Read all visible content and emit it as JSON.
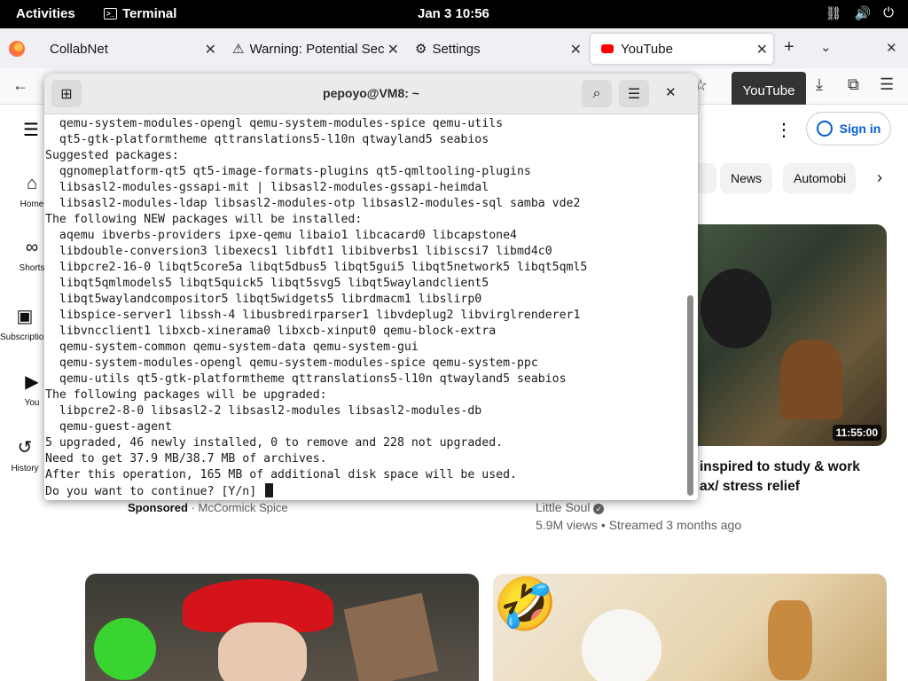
{
  "topbar": {
    "activities": "Activities",
    "app_name": "Terminal",
    "clock": "Jan 3  10:56"
  },
  "browser": {
    "tabs": [
      {
        "title": "CollabNet"
      },
      {
        "title": "Warning: Potential Sec"
      },
      {
        "title": "Settings"
      },
      {
        "title": "YouTube"
      }
    ],
    "tooltip": "YouTube",
    "new_tab": "+",
    "close_window": "✕"
  },
  "youtube": {
    "sidebar": [
      "Home",
      "Shorts",
      "Subscriptions",
      "You",
      "History"
    ],
    "sign_in": "Sign in",
    "chips": [
      "News",
      "Automobi"
    ],
    "video1": {
      "title_line1": "inspired to study & work",
      "title_line2": "ax/ stress relief",
      "channel": "Little Soul",
      "meta": "5.9M views • Streamed 3 months ago",
      "duration": "11:55:00"
    },
    "ad": {
      "sponsored": "Sponsored",
      "advertiser": "McCormick Spice"
    },
    "emoji": "🤣"
  },
  "terminal": {
    "title": "pepoyo@VM8: ~",
    "lines": [
      "  qemu-system-modules-opengl qemu-system-modules-spice qemu-utils",
      "  qt5-gtk-platformtheme qttranslations5-l10n qtwayland5 seabios",
      "Suggested packages:",
      "  qgnomeplatform-qt5 qt5-image-formats-plugins qt5-qmltooling-plugins",
      "  libsasl2-modules-gssapi-mit | libsasl2-modules-gssapi-heimdal",
      "  libsasl2-modules-ldap libsasl2-modules-otp libsasl2-modules-sql samba vde2",
      "The following NEW packages will be installed:",
      "  aqemu ibverbs-providers ipxe-qemu libaio1 libcacard0 libcapstone4",
      "  libdouble-conversion3 libexecs1 libfdt1 libibverbs1 libiscsi7 libmd4c0",
      "  libpcre2-16-0 libqt5core5a libqt5dbus5 libqt5gui5 libqt5network5 libqt5qml5",
      "  libqt5qmlmodels5 libqt5quick5 libqt5svg5 libqt5waylandclient5",
      "  libqt5waylandcompositor5 libqt5widgets5 librdmacm1 libslirp0",
      "  libspice-server1 libssh-4 libusbredirparser1 libvdeplug2 libvirglrenderer1",
      "  libvncclient1 libxcb-xinerama0 libxcb-xinput0 qemu-block-extra",
      "  qemu-system-common qemu-system-data qemu-system-gui",
      "  qemu-system-modules-opengl qemu-system-modules-spice qemu-system-ppc",
      "  qemu-utils qt5-gtk-platformtheme qttranslations5-l10n qtwayland5 seabios",
      "The following packages will be upgraded:",
      "  libpcre2-8-0 libsasl2-2 libsasl2-modules libsasl2-modules-db",
      "  qemu-guest-agent",
      "5 upgraded, 46 newly installed, 0 to remove and 228 not upgraded.",
      "Need to get 37.9 MB/38.7 MB of archives.",
      "After this operation, 165 MB of additional disk space will be used.",
      "Do you want to continue? [Y/n] "
    ]
  }
}
